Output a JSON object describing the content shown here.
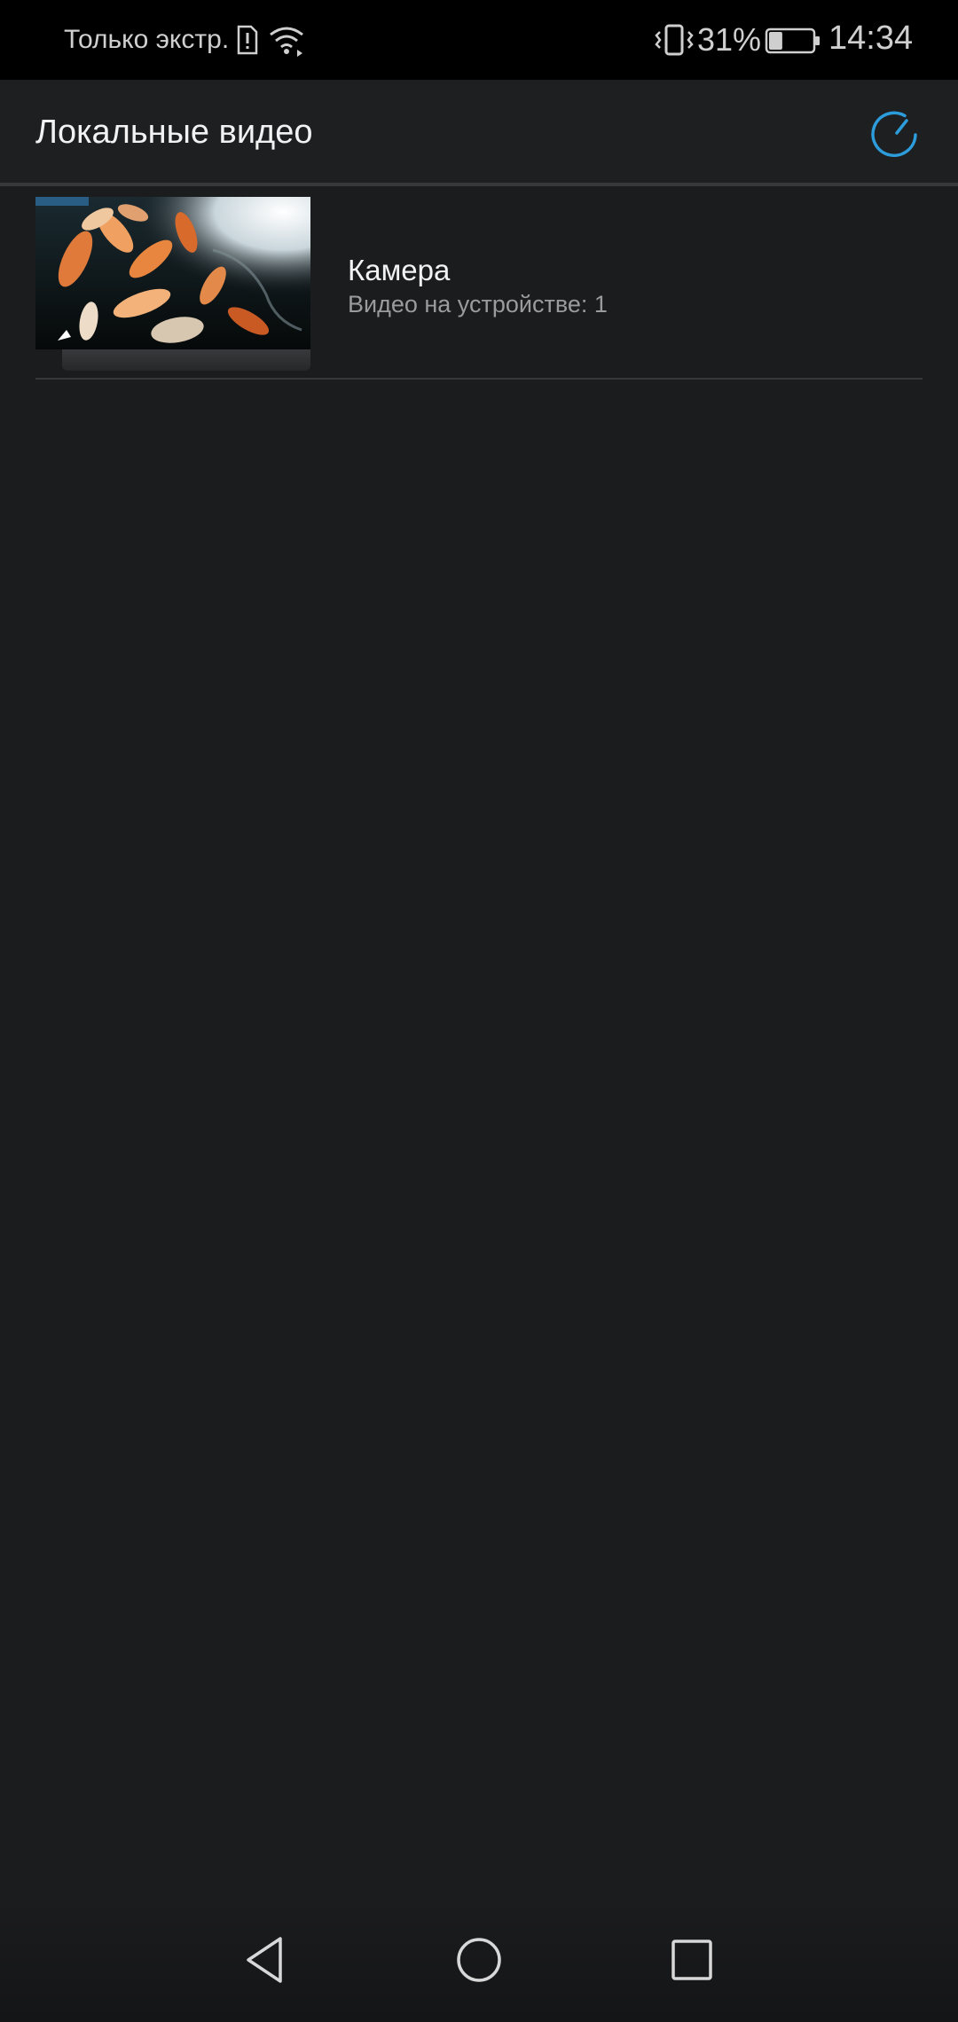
{
  "status_bar": {
    "carrier": "Только экстр.",
    "battery_percent": "31%",
    "time": "14:34",
    "battery_level": 0.31,
    "icons": [
      "sim-alert-icon",
      "wifi-icon",
      "vibrate-icon",
      "battery-icon"
    ]
  },
  "app_bar": {
    "title": "Локальные видео",
    "refresh_icon": "refresh-icon",
    "accent_color": "#2d9cdb"
  },
  "folders": [
    {
      "title": "Камера",
      "subtitle": "Видео на устройстве: 1",
      "thumbnail": "koi-fish-pond-video-thumbnail"
    }
  ],
  "nav_bar": {
    "icons": [
      "back-icon",
      "home-icon",
      "recents-icon"
    ]
  }
}
